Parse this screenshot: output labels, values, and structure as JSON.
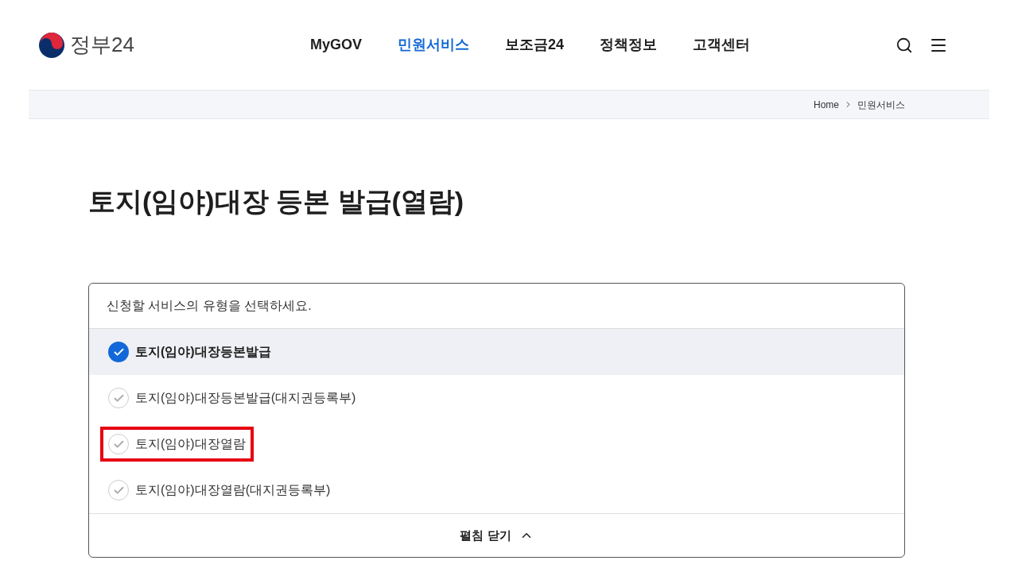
{
  "header": {
    "logo_text": "정부24",
    "nav": [
      {
        "label": "MyGOV",
        "selected": false
      },
      {
        "label": "민원서비스",
        "selected": true
      },
      {
        "label": "보조금24",
        "selected": false
      },
      {
        "label": "정책정보",
        "selected": false
      },
      {
        "label": "고객센터",
        "selected": false
      }
    ]
  },
  "breadcrumb": [
    "Home",
    "민원서비스"
  ],
  "page_title": "토지(임야)대장 등본 발급(열람)",
  "service_select": {
    "prompt": "신청할 서비스의 유형을 선택하세요.",
    "options": [
      {
        "label": "토지(임야)대장등본발급",
        "selected": true,
        "highlighted": false
      },
      {
        "label": "토지(임야)대장등본발급(대지권등록부)",
        "selected": false,
        "highlighted": false
      },
      {
        "label": "토지(임야)대장열람",
        "selected": false,
        "highlighted": true
      },
      {
        "label": "토지(임야)대장열람(대지권등록부)",
        "selected": false,
        "highlighted": false
      }
    ],
    "collapse_label": "펼침 닫기"
  }
}
